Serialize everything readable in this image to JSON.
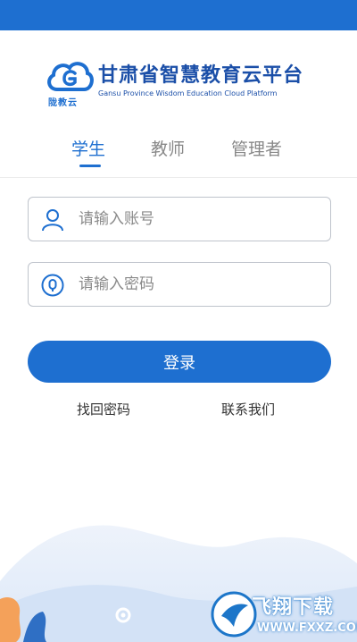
{
  "app": {
    "logo_text": "陇教云",
    "title": "甘肃省智慧教育云平台",
    "subtitle": "Gansu Province Wisdom Education Cloud Platform"
  },
  "tabs": [
    {
      "label": "学生",
      "active": true
    },
    {
      "label": "教师",
      "active": false
    },
    {
      "label": "管理者",
      "active": false
    }
  ],
  "form": {
    "account_placeholder": "请输入账号",
    "password_placeholder": "请输入密码",
    "login_label": "登录"
  },
  "links": {
    "forgot_password": "找回密码",
    "contact_us": "联系我们"
  },
  "watermark": {
    "main": "飞翔下载",
    "sub": "WWW.FXXZ.COM"
  },
  "colors": {
    "accent": "#1e6fd0",
    "title": "#1b4fa8",
    "tab_inactive": "#888888",
    "field_border": "#bfc4cc"
  },
  "icons": {
    "account": "user-icon",
    "password": "lock-icon",
    "logo": "cloud-logo-icon",
    "decor": "gear-icon"
  }
}
